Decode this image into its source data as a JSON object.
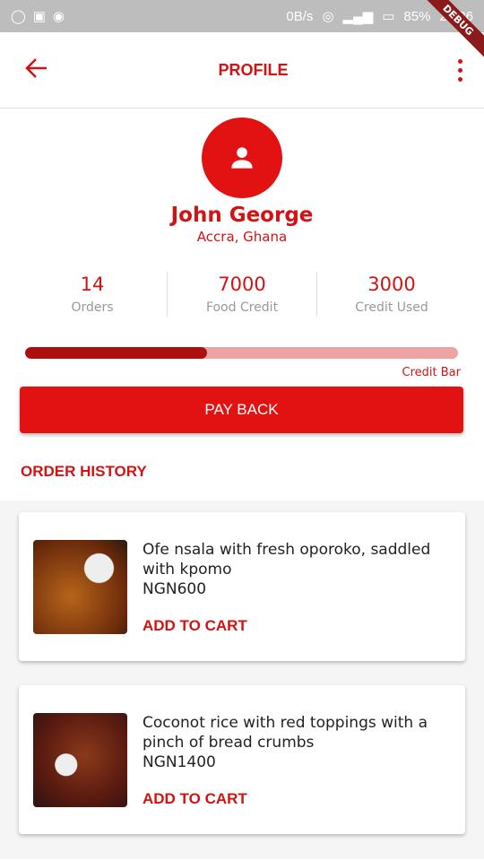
{
  "status_bar": {
    "net_speed": "0B/s",
    "battery": "85%",
    "time": "23:26",
    "debug_banner": "DEBUG"
  },
  "appbar": {
    "title": "PROFILE"
  },
  "profile": {
    "name": "John George",
    "location": "Accra, Ghana"
  },
  "stats": [
    {
      "value": "14",
      "label": "Orders"
    },
    {
      "value": "7000",
      "label": "Food Credit"
    },
    {
      "value": "3000",
      "label": "Credit Used"
    }
  ],
  "credit_bar": {
    "label": "Credit Bar",
    "progress": 0.42,
    "colors": {
      "fill": "#ad0f0f",
      "track": "#eea3a3"
    }
  },
  "pay_back_label": "PAY BACK",
  "order_history": {
    "title": "ORDER HISTORY",
    "items": [
      {
        "name": "Ofe nsala with fresh oporoko, saddled with kpomo",
        "price": "NGN600",
        "action": "ADD TO CART"
      },
      {
        "name": "Coconot rice with red toppings with a pinch of bread crumbs",
        "price": "NGN1400",
        "action": "ADD TO CART"
      }
    ]
  },
  "accent": "#e31212"
}
